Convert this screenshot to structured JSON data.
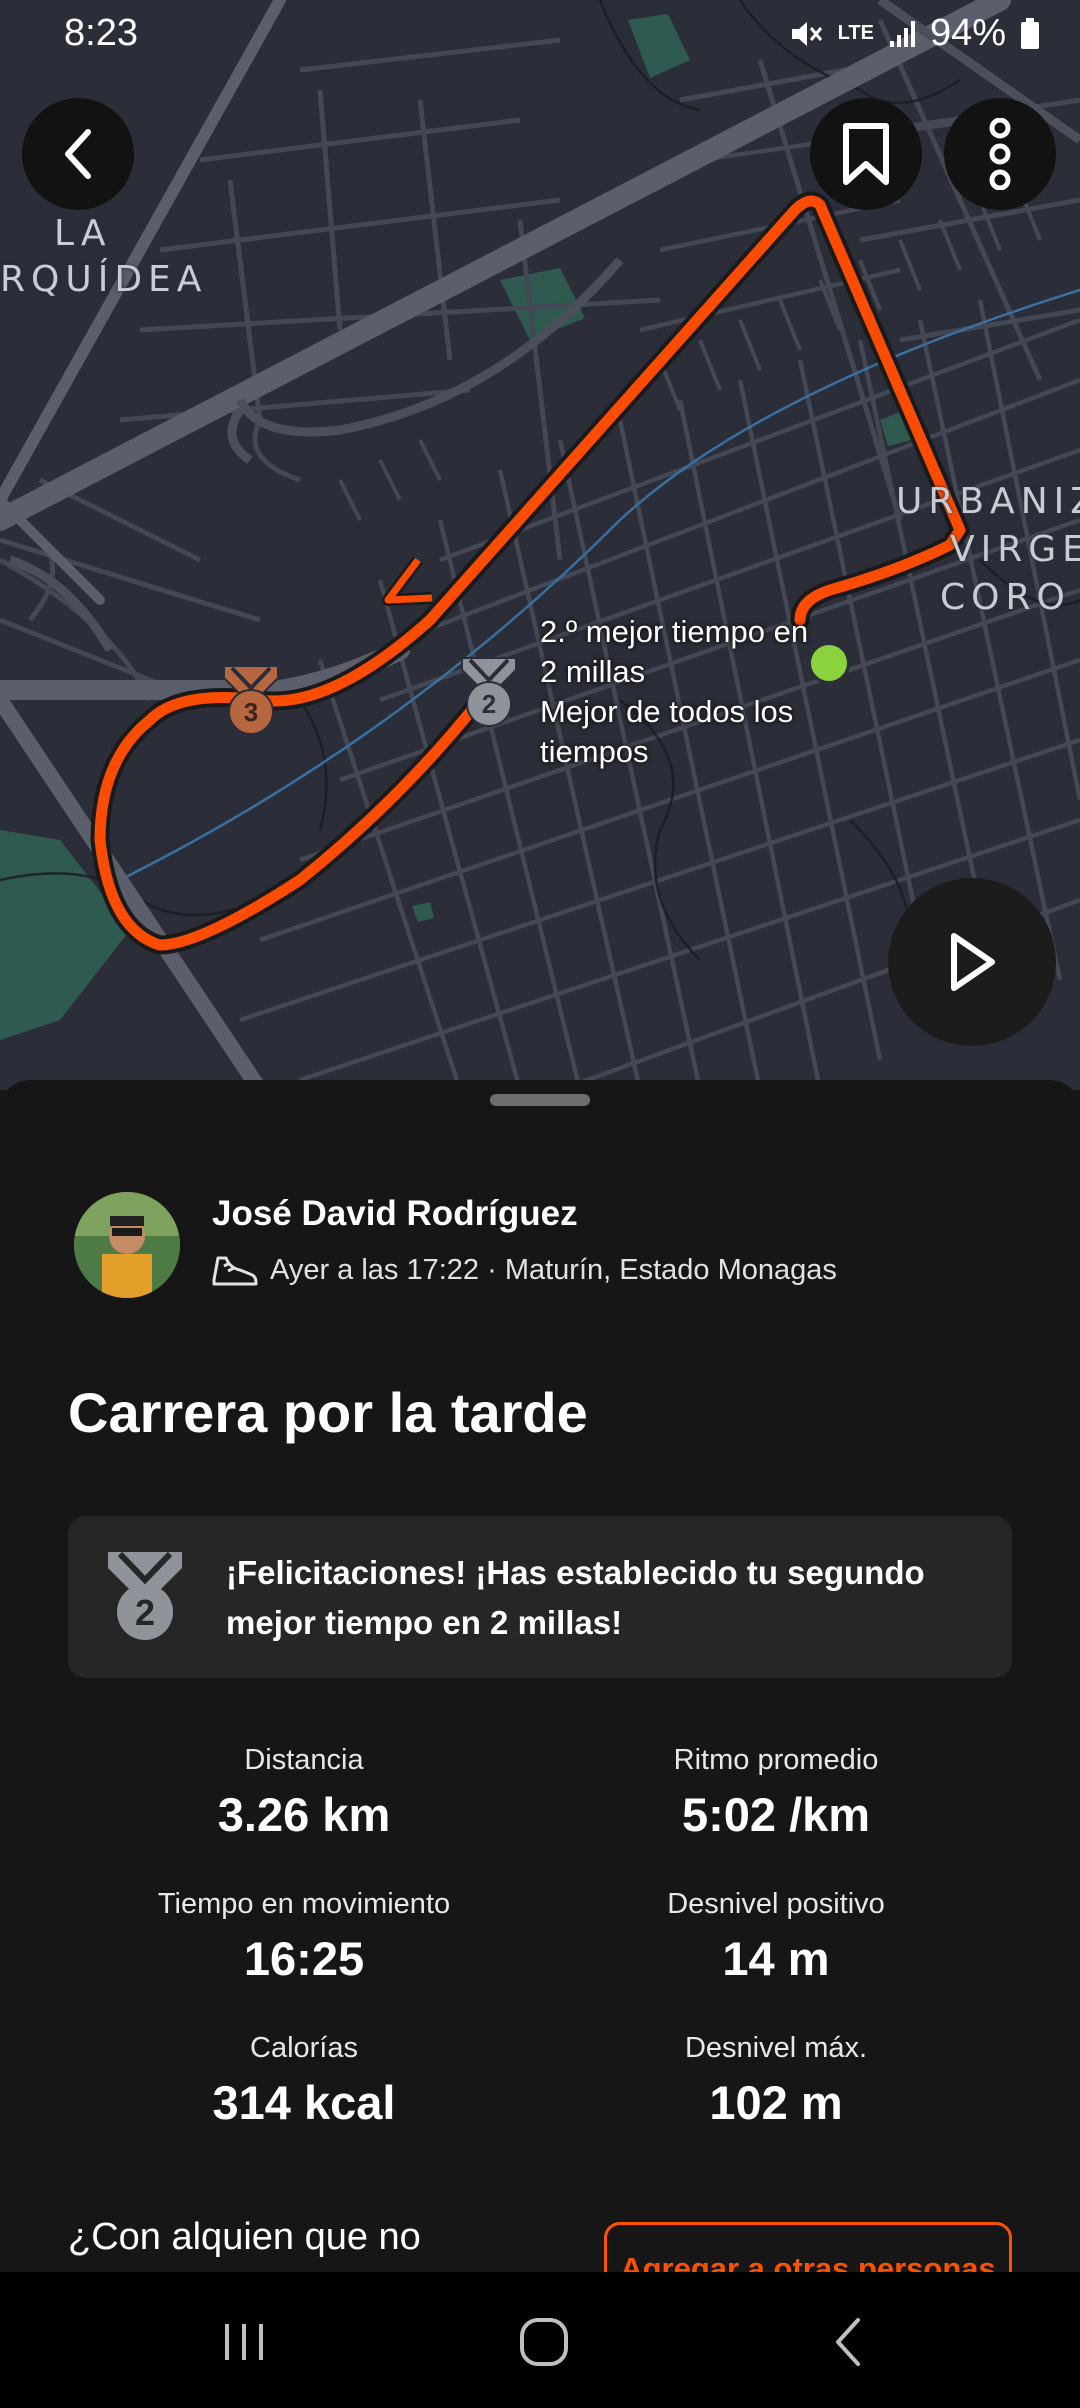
{
  "status_bar": {
    "time": "8:23",
    "network": "LTE",
    "battery": "94%"
  },
  "map": {
    "labels": {
      "neighborhood_1_line1": "LA",
      "neighborhood_1_line2": "RQUÍDEA",
      "neighborhood_2_line1": "URBANIZ",
      "neighborhood_2_line2": "VIRGE",
      "neighborhood_2_line3": "CORO"
    },
    "route_color": "#fc4c02",
    "medal_3_text": "3",
    "medal_2_text": "2",
    "pr_callout": {
      "line1": "2.º mejor tiempo en",
      "line2": "2 millas",
      "line3": "Mejor de todos los",
      "line4": "tiempos"
    },
    "icons": {
      "back": "chevron-left-icon",
      "bookmark": "bookmark-icon",
      "more": "more-vertical-icon",
      "play": "play-icon"
    }
  },
  "activity": {
    "athlete_name": "José David Rodríguez",
    "meta": "Ayer a las 17:22 · Maturín, Estado Monagas",
    "sport_icon": "running-shoe-icon",
    "title": "Carrera por la tarde",
    "achievement": {
      "medal_text": "2",
      "message": "¡Felicitaciones! ¡Has establecido tu segundo mejor tiempo en 2 millas!"
    },
    "stats": [
      {
        "label": "Distancia",
        "value": "3.26 km"
      },
      {
        "label": "Ritmo promedio",
        "value": "5:02 /km"
      },
      {
        "label": "Tiempo en movimiento",
        "value": "16:25"
      },
      {
        "label": "Desnivel positivo",
        "value": "14 m"
      },
      {
        "label": "Calorías",
        "value": "314 kcal"
      },
      {
        "label": "Desnivel máx.",
        "value": "102 m"
      }
    ],
    "question": "¿Con alquien que no",
    "add_others_label": "Agregar a otras personas"
  },
  "colors": {
    "accent": "#fc5200",
    "sheet_bg": "#161616",
    "map_bg": "#2b2e38"
  }
}
